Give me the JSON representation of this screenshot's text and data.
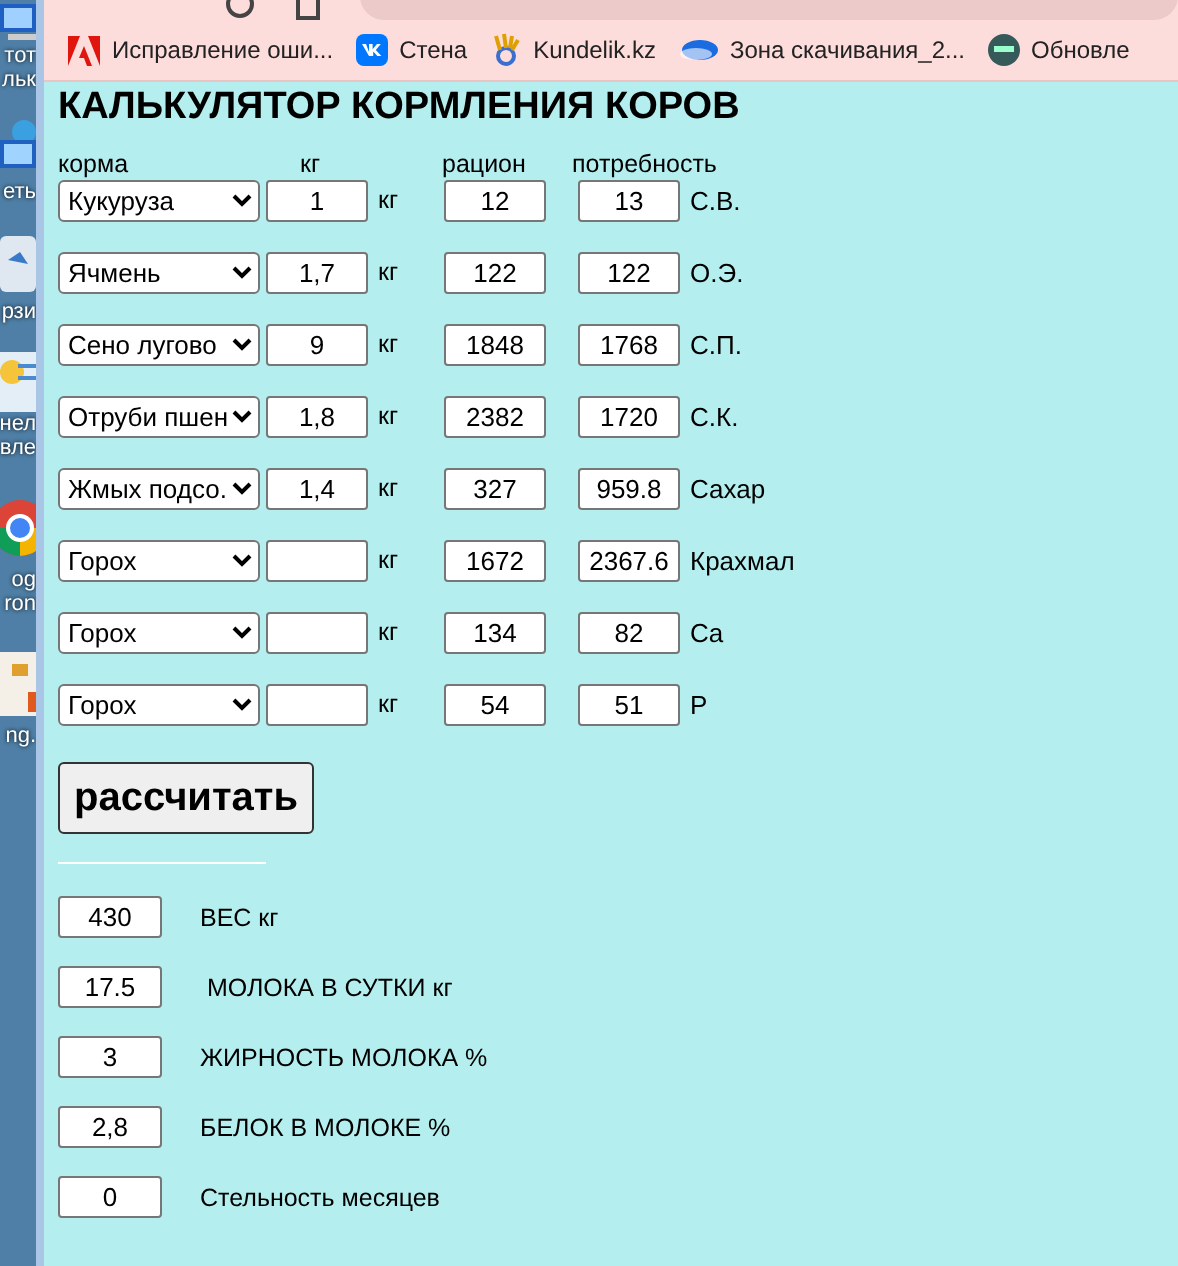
{
  "desktop_icons": [
    {
      "kind": "monitor",
      "lines": [
        "тот",
        "льк"
      ]
    },
    {
      "kind": "network",
      "lines": [
        "еть"
      ]
    },
    {
      "kind": "bin",
      "lines": [
        "рзи"
      ]
    },
    {
      "kind": "panel",
      "lines": [
        "нел",
        "вле"
      ]
    },
    {
      "kind": "chrome",
      "lines": [
        "og",
        "ron"
      ]
    },
    {
      "kind": "doc",
      "lines": [
        "ng."
      ]
    }
  ],
  "browser": {
    "bookmarks": [
      {
        "kind": "adobe",
        "label": "Исправление оши..."
      },
      {
        "kind": "vk",
        "label": "Стена"
      },
      {
        "kind": "hand",
        "label": "Kundelik.kz"
      },
      {
        "kind": "cloud",
        "label": "Зона скачивания_2..."
      },
      {
        "kind": "badge",
        "label": "Обновле"
      }
    ]
  },
  "page": {
    "title": "КАЛЬКУЛЯТОР КОРМЛЕНИЯ КОРОВ",
    "columns": [
      "корма",
      "кг",
      "рацион",
      "потребность"
    ],
    "rows": [
      {
        "feed": "Кукуруза",
        "kg": "1",
        "unit": "кг",
        "ration": "12",
        "need": "13",
        "nutrient": "С.В."
      },
      {
        "feed": "Ячмень",
        "kg": "1,7",
        "unit": "кг",
        "ration": "122",
        "need": "122",
        "nutrient": "О.Э."
      },
      {
        "feed": "Сено лугово",
        "kg": "9",
        "unit": "кг",
        "ration": "1848",
        "need": "1768",
        "nutrient": "С.П."
      },
      {
        "feed": "Отруби пшен",
        "kg": "1,8",
        "unit": "кг",
        "ration": "2382",
        "need": "1720",
        "nutrient": "С.К."
      },
      {
        "feed": "Жмых подсо.",
        "kg": "1,4",
        "unit": "кг",
        "ration": "327",
        "need": "959.8",
        "nutrient": "Сахар"
      },
      {
        "feed": "Горох",
        "unit": "кг",
        "ration": "1672",
        "need": "2367.6",
        "nutrient": "Крахмал"
      },
      {
        "feed": "Горох",
        "unit": "кг",
        "ration": "134",
        "need": "82",
        "nutrient": "Ca"
      },
      {
        "feed": "Горох",
        "unit": "кг",
        "ration": "54",
        "need": "51",
        "nutrient": "P"
      }
    ],
    "button": "рассчитать",
    "params": [
      {
        "value": "430",
        "label": "ВЕС кг"
      },
      {
        "value": "17.5",
        "label": " МОЛОКА В СУТКИ кг"
      },
      {
        "value": "3",
        "label": "ЖИРНОСТЬ МОЛОКА %"
      },
      {
        "value": "2,8",
        "label": "БЕЛОК В МОЛОКЕ %"
      },
      {
        "value": "0",
        "label": "Стельность месяцев"
      }
    ]
  }
}
